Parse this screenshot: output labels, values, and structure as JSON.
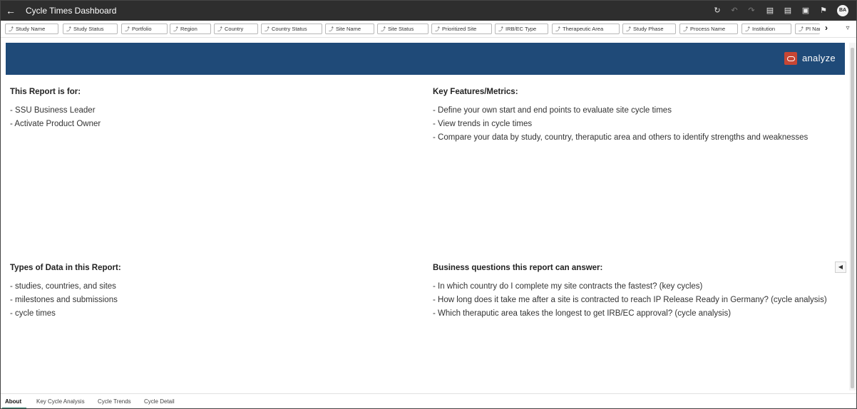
{
  "app": {
    "title": "Cycle Times Dashboard"
  },
  "header": {
    "user_initials": "BA",
    "icons": [
      "back-arrow-icon",
      "refresh-icon",
      "undo-icon",
      "redo-icon",
      "data-icon",
      "comment-icon",
      "present-icon",
      "bookmark-icon"
    ]
  },
  "filters": [
    "Study Name",
    "Study Status",
    "Portfolio",
    "Region",
    "Country",
    "Country Status",
    "Site Name",
    "Site Status",
    "Prioritized Site",
    "IRB/EC Type",
    "Therapeutic Area",
    "Study Phase",
    "Process Name",
    "Institution",
    "PI Name"
  ],
  "banner": {
    "brand": "analyze",
    "color": "#1f4a78",
    "logo_color": "#c74634"
  },
  "sections": {
    "report_for": {
      "title": "This Report is for:",
      "items": [
        "- SSU Business Leader",
        "- Activate Product Owner"
      ]
    },
    "key_features": {
      "title": "Key Features/Metrics:",
      "items": [
        "- Define your own start and end points to evaluate site cycle times",
        "- View trends in cycle times",
        "- Compare your data by study, country, theraputic area and others to identify strengths and weaknesses"
      ]
    },
    "data_types": {
      "title": "Types of Data in this Report:",
      "items": [
        "- studies, countries, and sites",
        "- milestones and submissions",
        "- cycle times"
      ]
    },
    "business_questions": {
      "title": "Business questions this report can answer:",
      "items": [
        "- In which country do I complete my site contracts the fastest? (key cycles)",
        "- How long does it take me after a site is contracted to reach IP Release Ready in Germany? (cycle analysis)",
        "- Which theraputic area takes the longest to get IRB/EC approval? (cycle analysis)"
      ]
    }
  },
  "tabs": [
    "About",
    "Key Cycle Analysis",
    "Cycle Trends",
    "Cycle Detail"
  ],
  "active_tab": "About",
  "accent_color": "#2d7d6a"
}
